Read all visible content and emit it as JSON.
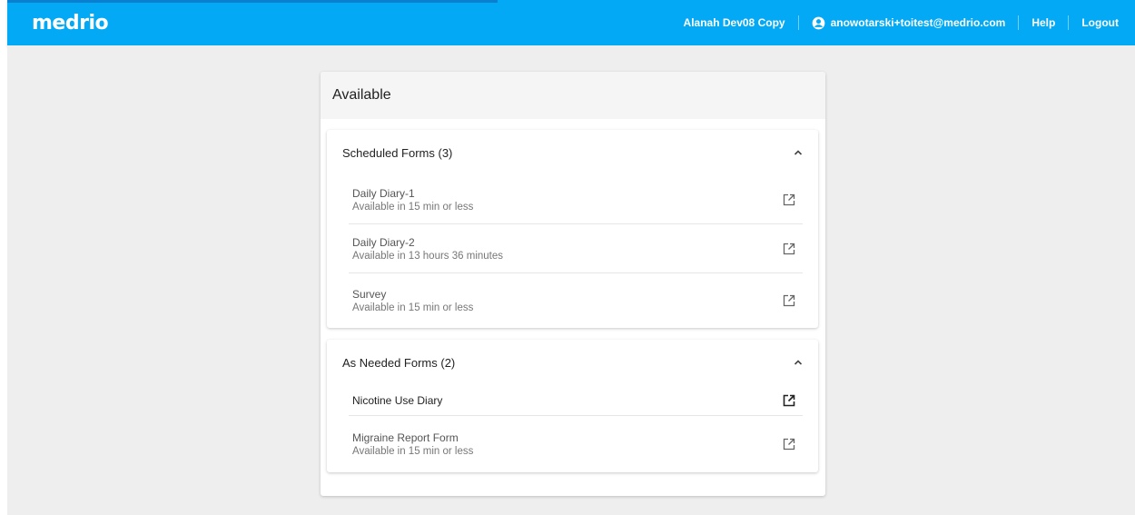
{
  "header": {
    "logo": "medrio",
    "study_name": "Alanah Dev08 Copy",
    "user_email": "anowotarski+toitest@medrio.com",
    "help_label": "Help",
    "logout_label": "Logout"
  },
  "card": {
    "title": "Available",
    "scheduled": {
      "title": "Scheduled Forms (3)",
      "items": [
        {
          "name": "Daily Diary-1",
          "status": "Available in 15 min or less"
        },
        {
          "name": "Daily Diary-2",
          "status": "Available in 13 hours 36 minutes"
        },
        {
          "name": "Survey",
          "status": "Available in 15 min or less"
        }
      ]
    },
    "as_needed": {
      "title": "As Needed Forms (2)",
      "items": [
        {
          "name": "Nicotine Use Diary"
        },
        {
          "name": "Migraine Report Form",
          "status": "Available in 15 min or less"
        }
      ]
    }
  },
  "colors": {
    "brand": "#03a9f4",
    "accent": "#0b7fcf",
    "background": "#eeeeee"
  },
  "icons": [
    "user-circle-icon",
    "chevron-up-icon",
    "open-in-new-icon"
  ]
}
